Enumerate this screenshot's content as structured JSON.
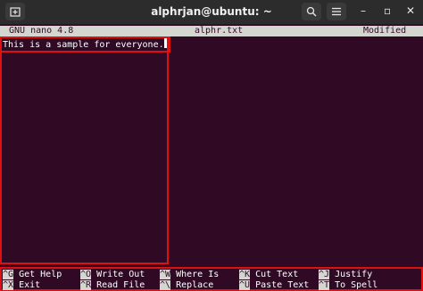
{
  "window": {
    "title": "alphrjan@ubuntu: ~"
  },
  "nano": {
    "version": "GNU nano 4.8",
    "filename": "alphr.txt",
    "status": "Modified",
    "text_line": "This is a sample for everyone."
  },
  "shortcuts": [
    {
      "key": "^G",
      "label": "Get Help"
    },
    {
      "key": "^O",
      "label": "Write Out"
    },
    {
      "key": "^W",
      "label": "Where Is"
    },
    {
      "key": "^K",
      "label": "Cut Text"
    },
    {
      "key": "^J",
      "label": "Justify"
    },
    {
      "key": "^X",
      "label": "Exit"
    },
    {
      "key": "^R",
      "label": "Read File"
    },
    {
      "key": "^\\",
      "label": "Replace"
    },
    {
      "key": "^U",
      "label": "Paste Text"
    },
    {
      "key": "^T",
      "label": "To Spell"
    }
  ],
  "colors": {
    "terminal_bg": "#300a24",
    "header_bg": "#d3d7cf",
    "highlight_red": "#e01010"
  },
  "icons": [
    "new-tab-icon",
    "search-icon",
    "hamburger-menu-icon",
    "minimize-icon",
    "maximize-icon",
    "close-icon"
  ]
}
